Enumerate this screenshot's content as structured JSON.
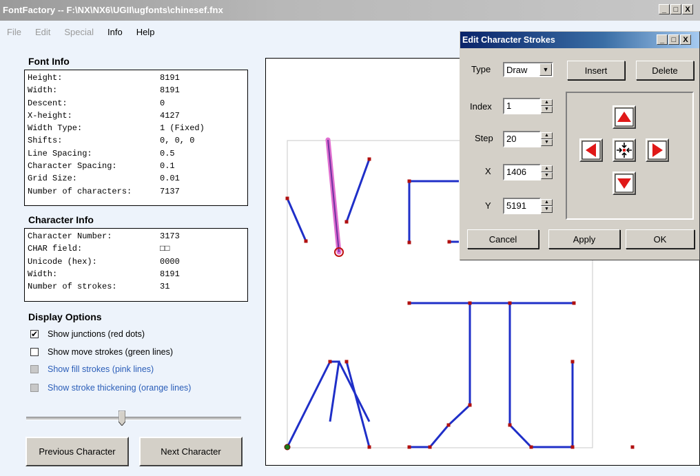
{
  "window": {
    "title": "FontFactory -- F:\\NX\\NX6\\UGII\\ugfonts\\chinesef.fnx",
    "controls": [
      "_",
      "□",
      "X"
    ]
  },
  "menu": [
    {
      "label": "File",
      "enabled": false
    },
    {
      "label": "Edit",
      "enabled": false
    },
    {
      "label": "Special",
      "enabled": false
    },
    {
      "label": "Info",
      "enabled": true
    },
    {
      "label": "Help",
      "enabled": true
    }
  ],
  "font_info": {
    "title": "Font Info",
    "rows": [
      {
        "key": "Height:",
        "value": "8191"
      },
      {
        "key": "Width:",
        "value": "8191"
      },
      {
        "key": "Descent:",
        "value": "0"
      },
      {
        "key": "X-height:",
        "value": "4127"
      },
      {
        "key": "Width Type:",
        "value": "1 (Fixed)"
      },
      {
        "key": "Shifts:",
        "value": "0, 0, 0"
      },
      {
        "key": "Line Spacing:",
        "value": "0.5"
      },
      {
        "key": "Character Spacing:",
        "value": "0.1"
      },
      {
        "key": "Grid Size:",
        "value": "0.01"
      },
      {
        "key": "Number of characters:",
        "value": "7137"
      }
    ]
  },
  "char_info": {
    "title": "Character Info",
    "rows": [
      {
        "key": "Character Number:",
        "value": "3173"
      },
      {
        "key": "CHAR field:",
        "value": "□□"
      },
      {
        "key": "Unicode (hex):",
        "value": "0000"
      },
      {
        "key": "Width:",
        "value": "8191"
      },
      {
        "key": "Number of strokes:",
        "value": "31"
      }
    ]
  },
  "display_options": {
    "title": "Display Options",
    "options": [
      {
        "label": "Show junctions (red dots)",
        "checked": true,
        "enabled": true
      },
      {
        "label": "Show move strokes (green lines)",
        "checked": false,
        "enabled": true
      },
      {
        "label": "Show fill strokes (pink lines)",
        "checked": false,
        "enabled": false
      },
      {
        "label": "Show stroke thickening (orange lines)",
        "checked": false,
        "enabled": false
      }
    ]
  },
  "slider": {
    "value_fraction": 0.45
  },
  "buttons": {
    "previous": "Previous Character",
    "next": "Next Character"
  },
  "dialog": {
    "title": "Edit Character Strokes",
    "type_label": "Type",
    "type_value": "Draw",
    "insert": "Insert",
    "delete": "Delete",
    "index_label": "Index",
    "index_value": "1",
    "step_label": "Step",
    "step_value": "20",
    "x_label": "X",
    "x_value": "1406",
    "y_label": "Y",
    "y_value": "5191",
    "cancel": "Cancel",
    "apply": "Apply",
    "ok": "OK"
  },
  "colors": {
    "stroke": "#1f2fc8",
    "junction": "#b01010",
    "selected": "#e070d0",
    "arrow": "#e01818"
  }
}
